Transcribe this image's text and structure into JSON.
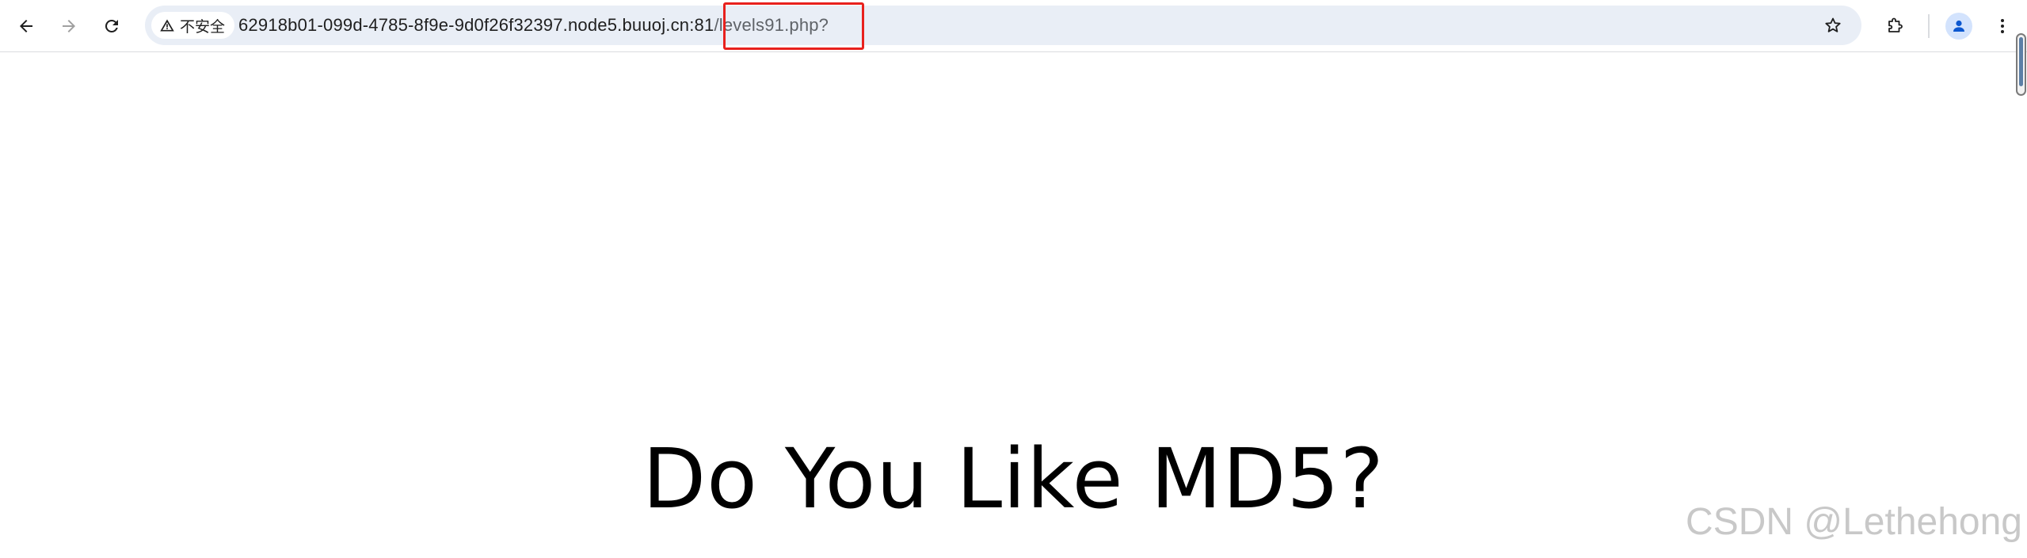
{
  "browser": {
    "security_label": "不安全",
    "url_host": "62918b01-099d-4785-8f9e-9d0f26f32397.node5.buuoj.cn:81",
    "url_path": "/levels91.php?",
    "highlight_color": "#e8211d"
  },
  "page": {
    "heading": "Do You Like MD5?"
  },
  "watermark": "CSDN @Lethehong"
}
